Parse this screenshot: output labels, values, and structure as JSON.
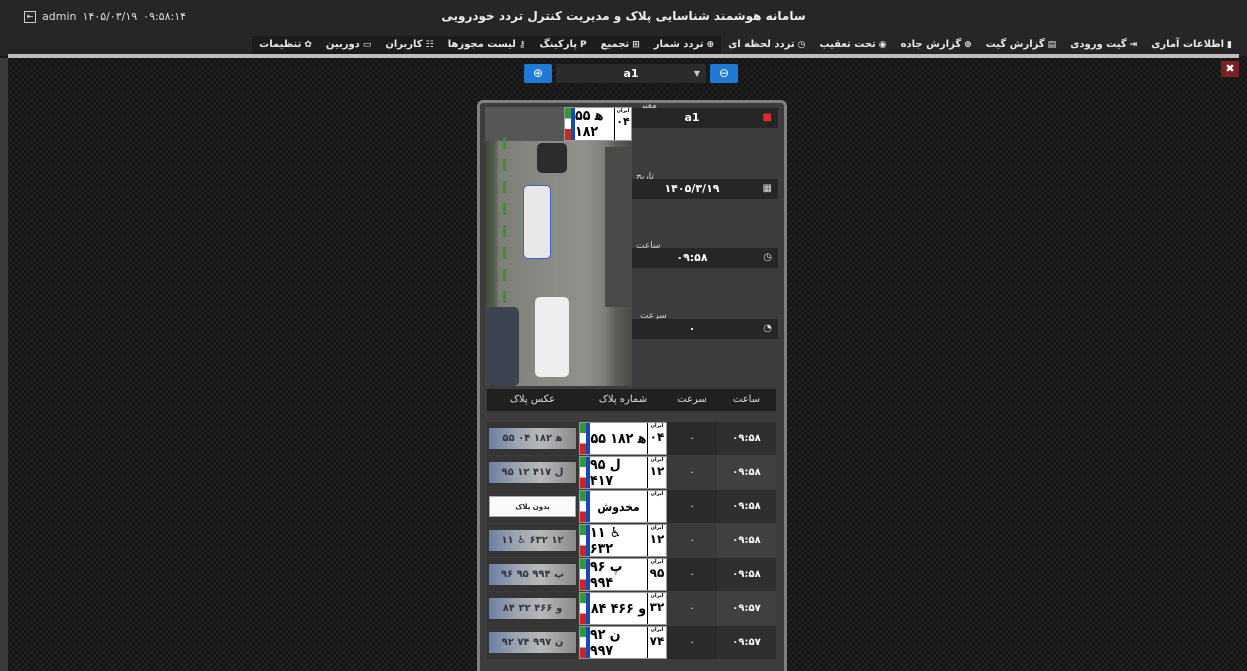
{
  "header": {
    "user": "admin",
    "date": "۱۴۰۵/۰۳/۱۹",
    "time": "۰۹:۵۸:۱۴",
    "title": "سامانه هوشمند شناسایی پلاک و مدیریت کنترل تردد خودرویی"
  },
  "menu": [
    {
      "label": "اطلاعات آماری",
      "icon": "bar-chart-icon",
      "glyph": "▮"
    },
    {
      "label": "گیت ورودی",
      "icon": "login-icon",
      "glyph": "⇥"
    },
    {
      "label": "گزارش گیت",
      "icon": "report-icon",
      "glyph": "▤"
    },
    {
      "label": "گزارش جاده",
      "icon": "road-report-icon",
      "glyph": "⊕"
    },
    {
      "label": "تحت تعقیب",
      "icon": "target-icon",
      "glyph": "◉"
    },
    {
      "label": "تردد لحظه ای",
      "icon": "clock-icon",
      "glyph": "◷"
    },
    {
      "label": "تردد شمار",
      "icon": "counter-icon",
      "glyph": "⊕"
    },
    {
      "label": "تجمیع",
      "icon": "grid-icon",
      "glyph": "⊞"
    },
    {
      "label": "پارکینگ",
      "icon": "parking-icon",
      "glyph": "P"
    },
    {
      "label": "لیست مجوزها",
      "icon": "key-icon",
      "glyph": "⚷"
    },
    {
      "label": "کاربران",
      "icon": "users-icon",
      "glyph": "☷"
    },
    {
      "label": "دوربین",
      "icon": "camera-icon",
      "glyph": "▭"
    },
    {
      "label": "تنظیمات",
      "icon": "settings-icon",
      "glyph": "✿"
    }
  ],
  "camera": {
    "selected": "a1"
  },
  "detail": {
    "passage_label": "معبر",
    "passage_value": "a1",
    "date_label": "تاریخ",
    "date_value": "۱۴۰۵/۳/۱۹",
    "time_label": "ساعت",
    "time_value": "۰۹:۵۸",
    "speed_label": "سرعت",
    "speed_value": "۰",
    "plate": {
      "main": "۵۵ ﻫ ۱۸۲",
      "region": "۰۴",
      "iran": "ایران"
    }
  },
  "table": {
    "headers": {
      "time": "ساعت",
      "speed": "سرعت",
      "plate": "شماره پلاک",
      "photo": "عکس پلاک"
    },
    "rows": [
      {
        "time": "۰۹:۵۸",
        "speed": "۰",
        "plate_main": "۵۵ ﻫ ۱۸۲",
        "region": "۰۴",
        "photo_text": "۵۵ ﻫ ۱۸۲ ۰۴"
      },
      {
        "time": "۰۹:۵۸",
        "speed": "۰",
        "plate_main": "۹۵ ل ۴۱۷",
        "region": "۱۲",
        "photo_text": "۹۵ ل ۴۱۷ ۱۲"
      },
      {
        "time": "۰۹:۵۸",
        "speed": "۰",
        "plate_main": "مخدوش",
        "region": "",
        "photo_text": "بدون پلاک",
        "damaged": true
      },
      {
        "time": "۰۹:۵۸",
        "speed": "۰",
        "plate_main": "۱۱ ♿ ۶۳۲",
        "region": "۱۲",
        "photo_text": "۱۱ ♿ ۶۳۲ ۱۲"
      },
      {
        "time": "۰۹:۵۸",
        "speed": "۰",
        "plate_main": "۹۶ پ ۹۹۴",
        "region": "۹۵",
        "photo_text": "۹۶ پ ۹۹۴ ۹۵"
      },
      {
        "time": "۰۹:۵۷",
        "speed": "۰",
        "plate_main": "۸۴ و ۴۶۶",
        "region": "۳۲",
        "photo_text": "۸۴ و ۴۶۶ ۳۲"
      },
      {
        "time": "۰۹:۵۷",
        "speed": "۰",
        "plate_main": "۹۲ ن ۹۹۷",
        "region": "۷۴",
        "photo_text": "۹۲ ن ۹۹۷ ۷۴"
      }
    ]
  },
  "colors": {
    "accent": "#1e7ad6",
    "close": "#7a1f24",
    "passage_marker": "#d32f2f"
  }
}
